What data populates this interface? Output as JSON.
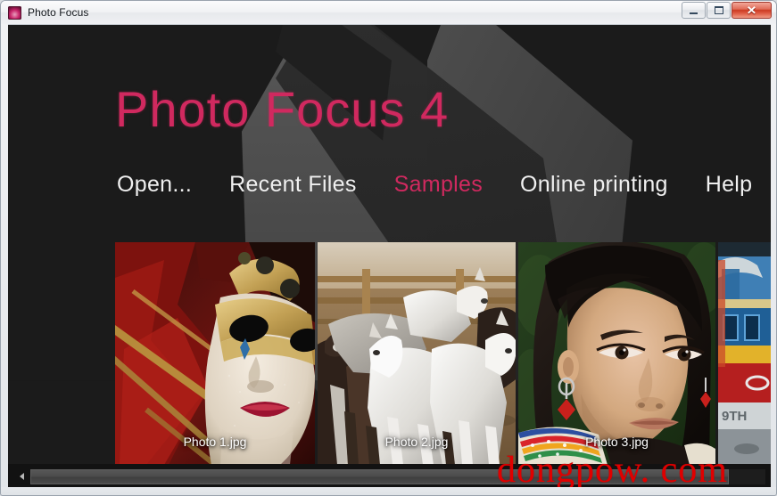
{
  "window": {
    "title": "Photo Focus",
    "icon": "app-logo-icon",
    "controls": {
      "minimize": "–",
      "maximize": "□",
      "close": "✕"
    }
  },
  "branding": {
    "title": "Photo Focus 4",
    "accent_color": "#d0295f",
    "background_color": "#1b1b1b",
    "decoration": "camera-aperture-blades"
  },
  "menu": {
    "items": [
      {
        "label": "Open...",
        "active": false
      },
      {
        "label": "Recent Files",
        "active": false
      },
      {
        "label": "Samples",
        "active": true
      },
      {
        "label": "Online printing",
        "active": false
      },
      {
        "label": "Help",
        "active": false
      }
    ]
  },
  "samples": {
    "thumbnails": [
      {
        "label": "Photo 1.jpg",
        "subject": "venetian-carnival-mask"
      },
      {
        "label": "Photo 2.jpg",
        "subject": "white-horses-running"
      },
      {
        "label": "Photo 3.jpg",
        "subject": "young-girl-portrait"
      },
      {
        "label": "",
        "subject": "fishing-boat-partial"
      }
    ]
  },
  "scrollbar": {
    "left_arrow": "◀",
    "orientation": "horizontal"
  },
  "watermark": {
    "text": "dongpow. com",
    "color": "#e00000"
  }
}
